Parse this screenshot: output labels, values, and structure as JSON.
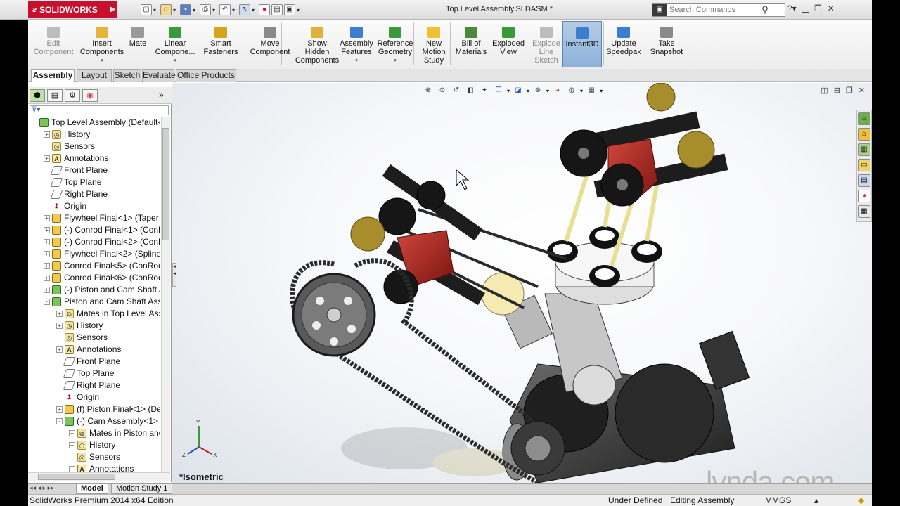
{
  "app": {
    "brand": "SOLIDWORKS",
    "document_title": "Top Level Assembly.SLDASM *"
  },
  "search": {
    "placeholder": "Search Commands"
  },
  "ribbon": [
    {
      "label": "Edit\nComponent",
      "enabled": false,
      "icon": "edit-component-icon"
    },
    {
      "label": "Insert\nComponents",
      "enabled": true,
      "icon": "insert-components-icon"
    },
    {
      "label": "Mate",
      "enabled": true,
      "icon": "mate-icon"
    },
    {
      "label": "Linear\nCompone...",
      "enabled": true,
      "icon": "linear-pattern-icon"
    },
    {
      "label": "Smart\nFasteners",
      "enabled": true,
      "icon": "smart-fasteners-icon"
    },
    {
      "label": "Move\nComponent",
      "enabled": true,
      "icon": "move-component-icon"
    },
    {
      "label": "Show\nHidden\nComponents",
      "enabled": true,
      "icon": "show-hidden-icon"
    },
    {
      "label": "Assembly\nFeatures",
      "enabled": true,
      "icon": "assembly-features-icon"
    },
    {
      "label": "Reference\nGeometry",
      "enabled": true,
      "icon": "reference-geometry-icon"
    },
    {
      "label": "New\nMotion\nStudy",
      "enabled": true,
      "icon": "motion-study-icon"
    },
    {
      "label": "Bill of\nMaterials",
      "enabled": true,
      "icon": "bom-icon"
    },
    {
      "label": "Exploded\nView",
      "enabled": true,
      "icon": "exploded-view-icon"
    },
    {
      "label": "Explode\nLine\nSketch",
      "enabled": false,
      "icon": "explode-line-icon"
    },
    {
      "label": "Instant3D",
      "enabled": true,
      "active": true,
      "icon": "instant3d-icon"
    },
    {
      "label": "Update\nSpeedpak",
      "enabled": true,
      "icon": "speedpak-icon"
    },
    {
      "label": "Take\nSnapshot",
      "enabled": true,
      "icon": "snapshot-icon"
    }
  ],
  "tabs": [
    "Assembly",
    "Layout",
    "Sketch",
    "Evaluate",
    "Office Products"
  ],
  "tree": [
    {
      "label": "Top Level Assembly  (Default<Dis",
      "indent": 0,
      "icon": "top-assembly-icon",
      "expander": ""
    },
    {
      "label": "History",
      "indent": 1,
      "icon": "history-icon",
      "expander": "+"
    },
    {
      "label": "Sensors",
      "indent": 1,
      "icon": "sensors-icon",
      "expander": ""
    },
    {
      "label": "Annotations",
      "indent": 1,
      "icon": "annotations-icon",
      "expander": "+"
    },
    {
      "label": "Front Plane",
      "indent": 1,
      "icon": "plane-icon",
      "expander": ""
    },
    {
      "label": "Top Plane",
      "indent": 1,
      "icon": "plane-icon",
      "expander": ""
    },
    {
      "label": "Right Plane",
      "indent": 1,
      "icon": "plane-icon",
      "expander": ""
    },
    {
      "label": "Origin",
      "indent": 1,
      "icon": "origin-icon",
      "expander": ""
    },
    {
      "label": "Flywheel Final<1> (Taper Shaf",
      "indent": 1,
      "icon": "part-icon",
      "expander": "+"
    },
    {
      "label": "(-) Conrod Final<1> (ConRod",
      "indent": 1,
      "icon": "part-icon",
      "expander": "+"
    },
    {
      "label": "(-) Conrod Final<2> (ConRod-",
      "indent": 1,
      "icon": "part-icon",
      "expander": "+"
    },
    {
      "label": "Flywheel Final<2> (Spline Shat",
      "indent": 1,
      "icon": "part-icon",
      "expander": "+"
    },
    {
      "label": "Conrod Final<5> (ConRod Cu",
      "indent": 1,
      "icon": "part-icon",
      "expander": "+"
    },
    {
      "label": "Conrod Final<6> (ConRod<<E",
      "indent": 1,
      "icon": "part-icon",
      "expander": "+"
    },
    {
      "label": "(-) Piston and Cam Shaft Asser",
      "indent": 1,
      "icon": "subassembly-icon",
      "expander": "+"
    },
    {
      "label": "Piston and Cam Shaft Assemb",
      "indent": 1,
      "icon": "subassembly-icon",
      "expander": "-"
    },
    {
      "label": "Mates in Top Level Assemb",
      "indent": 2,
      "icon": "mates-icon",
      "expander": "+"
    },
    {
      "label": "History",
      "indent": 2,
      "icon": "history-icon",
      "expander": "+"
    },
    {
      "label": "Sensors",
      "indent": 2,
      "icon": "sensors-icon",
      "expander": ""
    },
    {
      "label": "Annotations",
      "indent": 2,
      "icon": "annotations-icon",
      "expander": "+"
    },
    {
      "label": "Front Plane",
      "indent": 2,
      "icon": "plane-icon",
      "expander": ""
    },
    {
      "label": "Top Plane",
      "indent": 2,
      "icon": "plane-icon",
      "expander": ""
    },
    {
      "label": "Right Plane",
      "indent": 2,
      "icon": "plane-icon",
      "expander": ""
    },
    {
      "label": "Origin",
      "indent": 2,
      "icon": "origin-icon",
      "expander": ""
    },
    {
      "label": "(f) Piston Final<1> (Defaul",
      "indent": 2,
      "icon": "part-icon",
      "expander": "+"
    },
    {
      "label": "(-) Cam Assembly<1> (Det",
      "indent": 2,
      "icon": "subassembly-icon",
      "expander": "-"
    },
    {
      "label": "Mates in Piston and Ca",
      "indent": 3,
      "icon": "mates-icon",
      "expander": "+"
    },
    {
      "label": "History",
      "indent": 3,
      "icon": "history-icon",
      "expander": "+"
    },
    {
      "label": "Sensors",
      "indent": 3,
      "icon": "sensors-icon",
      "expander": ""
    },
    {
      "label": "Annotations",
      "indent": 3,
      "icon": "annotations-icon",
      "expander": "+"
    }
  ],
  "bottom_tabs": [
    "Model",
    "Motion Study 1"
  ],
  "status": {
    "edition": "SolidWorks Premium 2014 x64 Edition",
    "definition": "Under Defined",
    "mode": "Editing Assembly",
    "units": "MMGS"
  },
  "viewport": {
    "view_name": "*Isometric",
    "triad_axes": [
      "X",
      "Y",
      "Z"
    ]
  },
  "watermark": "lynda.com",
  "colors": {
    "accent": "#c8102e",
    "active_button": "#8eb2da",
    "chain": "#2b2b2b",
    "conrod_red": "#a8231c",
    "valve_cream": "#f2e9a8"
  }
}
